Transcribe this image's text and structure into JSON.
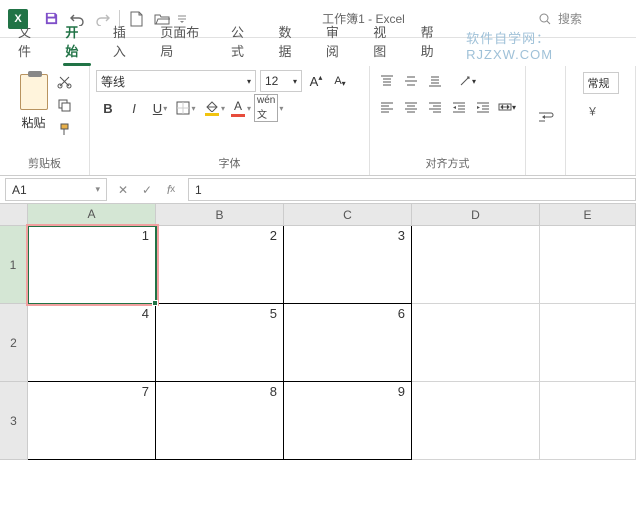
{
  "title": "工作簿1 - Excel",
  "search_placeholder": "搜索",
  "tabs": {
    "file": "文件",
    "home": "开始",
    "insert": "插入",
    "layout": "页面布局",
    "formulas": "公式",
    "data": "数据",
    "review": "审阅",
    "view": "视图",
    "help": "帮助"
  },
  "watermark": "软件自学网：RJZXW.COM",
  "ribbon": {
    "clipboard_label": "剪贴板",
    "paste_label": "粘贴",
    "font_label": "字体",
    "font_name": "等线",
    "font_size": "12",
    "align_label": "对齐方式",
    "number_label": "常规"
  },
  "namebox": "A1",
  "formula_value": "1",
  "columns": [
    "A",
    "B",
    "C",
    "D",
    "E"
  ],
  "rows": [
    "1",
    "2",
    "3"
  ],
  "grid": [
    [
      "1",
      "2",
      "3",
      "",
      ""
    ],
    [
      "4",
      "5",
      "6",
      "",
      ""
    ],
    [
      "7",
      "8",
      "9",
      "",
      ""
    ]
  ],
  "chart_data": {
    "type": "table",
    "columns": [
      "A",
      "B",
      "C"
    ],
    "rows": [
      [
        1,
        2,
        3
      ],
      [
        4,
        5,
        6
      ],
      [
        7,
        8,
        9
      ]
    ]
  }
}
